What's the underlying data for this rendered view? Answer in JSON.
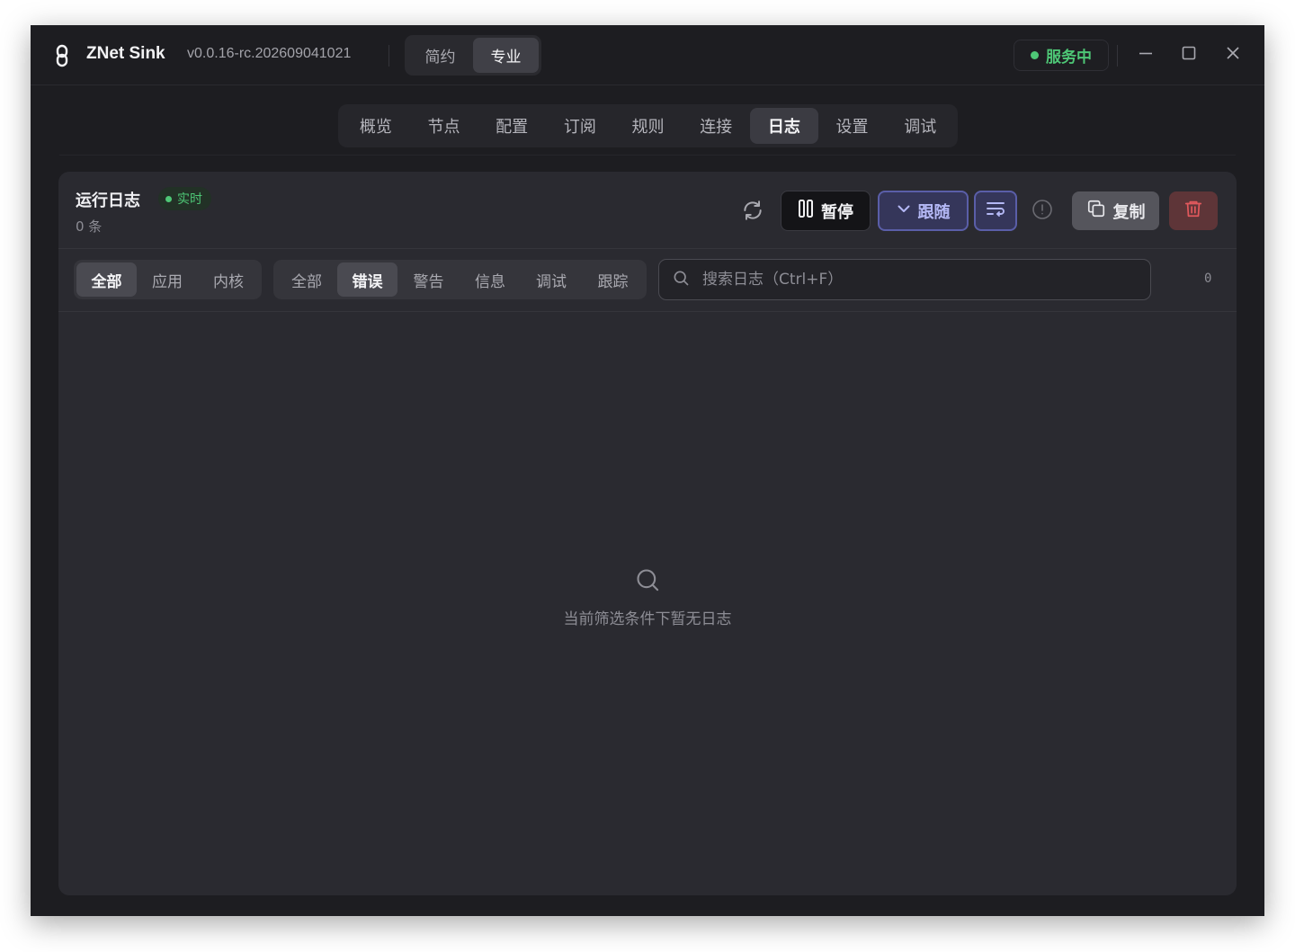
{
  "app": {
    "name": "ZNet Sink",
    "version": "v0.0.16-rc.202609041021",
    "logo_icon": "chain-link-icon"
  },
  "mode_switch": {
    "options": [
      "简约",
      "专业"
    ],
    "selected": "专业"
  },
  "status": {
    "label": "服务中",
    "color": "#4ec776"
  },
  "window_controls": [
    "minimize-icon",
    "maximize-icon",
    "close-icon"
  ],
  "nav": {
    "tabs": [
      "概览",
      "节点",
      "配置",
      "订阅",
      "规则",
      "连接",
      "日志",
      "设置",
      "调试"
    ],
    "active": "日志"
  },
  "log_panel": {
    "title": "运行日志",
    "live_badge": "实时",
    "count_text": "0 条",
    "toolbar": {
      "refresh_icon": "refresh-icon",
      "pause_label": "暂停",
      "follow_label": "跟随",
      "wrap_icon": "wrap-lines-icon",
      "info_icon": "alert-circle-icon",
      "copy_label": "复制",
      "delete_icon": "trash-icon"
    },
    "source_filter": {
      "options": [
        "全部",
        "应用",
        "内核"
      ],
      "selected": "全部"
    },
    "level_filter": {
      "options": [
        "全部",
        "错误",
        "警告",
        "信息",
        "调试",
        "跟踪"
      ],
      "selected": "错误"
    },
    "search": {
      "placeholder": "搜索日志（Ctrl+F）",
      "value": ""
    },
    "match_count": "0",
    "empty_message": "当前筛选条件下暂无日志"
  },
  "colors": {
    "accent": "#5a5ea8",
    "danger": "#e0585c",
    "success": "#4ec776"
  }
}
